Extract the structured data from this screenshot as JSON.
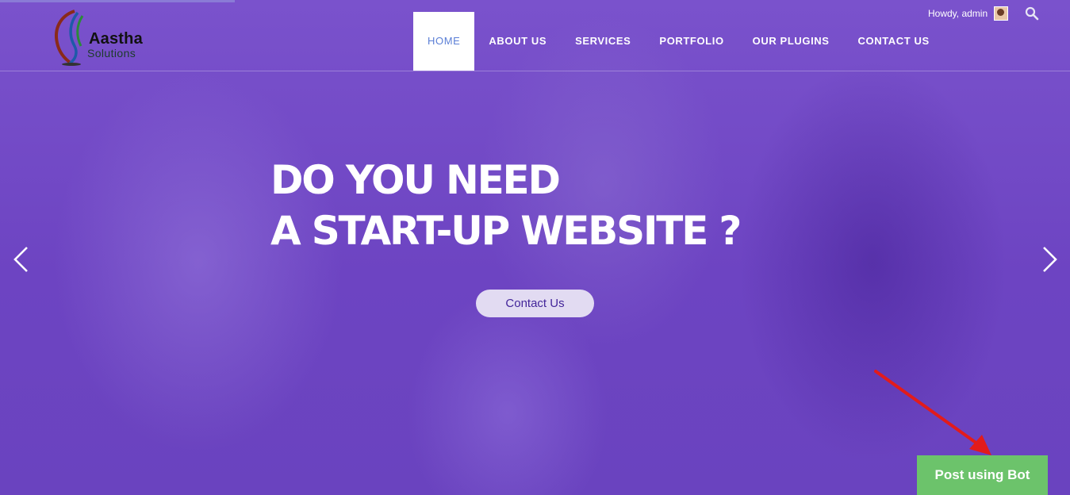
{
  "brand": {
    "name": "Aastha",
    "sub": "Solutions"
  },
  "nav": {
    "items": [
      {
        "label": "HOME",
        "active": true
      },
      {
        "label": "ABOUT US"
      },
      {
        "label": "SERVICES"
      },
      {
        "label": "PORTFOLIO"
      },
      {
        "label": "OUR PLUGINS"
      },
      {
        "label": "CONTACT US"
      }
    ]
  },
  "admin": {
    "greeting": "Howdy, admin",
    "search_icon": "search-icon"
  },
  "hero": {
    "line1": "DO YOU NEED",
    "line2": "A START-UP WEBSITE ?",
    "cta": "Contact Us",
    "prev_icon": "chevron-left-icon",
    "next_icon": "chevron-right-icon"
  },
  "bot_button": {
    "label": "Post using Bot"
  },
  "colors": {
    "hero_overlay": "#6f45c4",
    "nav_active_text": "#5b7fd6",
    "bot_button": "#6cc36b",
    "annotation_arrow": "#e21b1b"
  }
}
